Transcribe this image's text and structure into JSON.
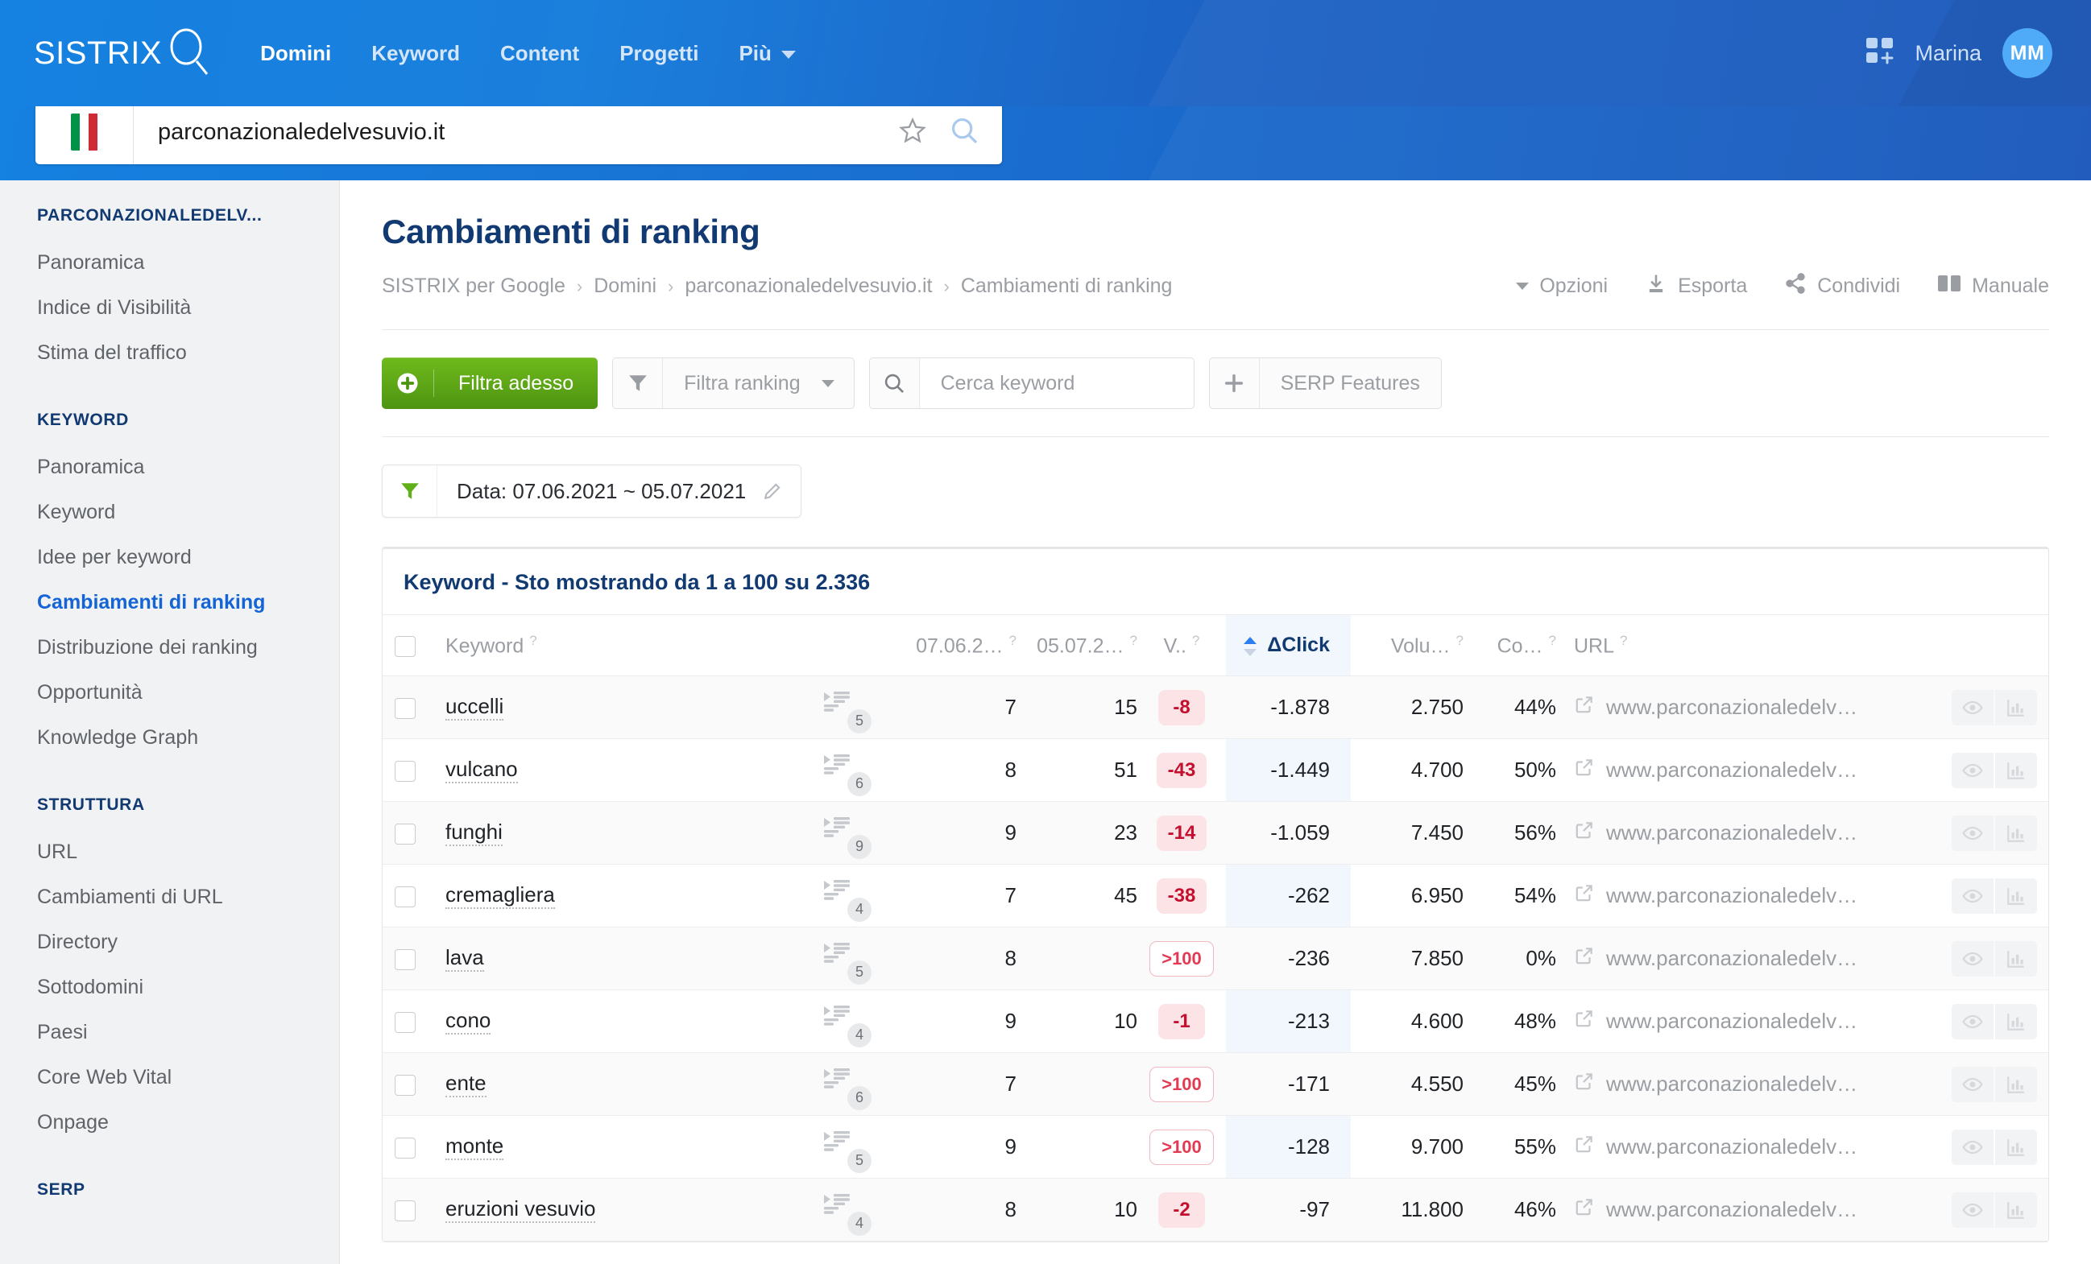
{
  "topnav": {
    "brand": "SISTRIX",
    "menu": [
      {
        "label": "Domini",
        "active": true
      },
      {
        "label": "Keyword",
        "active": false
      },
      {
        "label": "Content",
        "active": false
      },
      {
        "label": "Progetti",
        "active": false
      },
      {
        "label": "Più",
        "active": false,
        "caret": true
      }
    ],
    "apps_icon": "apps-grid-plus-icon",
    "user_name": "Marina",
    "avatar_initials": "MM"
  },
  "search": {
    "flag": "italy-flag",
    "value": "parconazionaledelvesuvio.it",
    "star_icon": "star-outline-icon",
    "search_icon": "magnifier-icon"
  },
  "sidebar": {
    "groups": [
      {
        "header": "PARCONAZIONALEDELV...",
        "items": [
          {
            "label": "Panoramica",
            "active": false
          },
          {
            "label": "Indice di Visibilità",
            "active": false
          },
          {
            "label": "Stima del traffico",
            "active": false
          }
        ]
      },
      {
        "header": "KEYWORD",
        "items": [
          {
            "label": "Panoramica",
            "active": false
          },
          {
            "label": "Keyword",
            "active": false
          },
          {
            "label": "Idee per keyword",
            "active": false
          },
          {
            "label": "Cambiamenti di ranking",
            "active": true
          },
          {
            "label": "Distribuzione dei ranking",
            "active": false
          },
          {
            "label": "Opportunità",
            "active": false
          },
          {
            "label": "Knowledge Graph",
            "active": false
          }
        ]
      },
      {
        "header": "STRUTTURA",
        "items": [
          {
            "label": "URL",
            "active": false
          },
          {
            "label": "Cambiamenti di URL",
            "active": false
          },
          {
            "label": "Directory",
            "active": false
          },
          {
            "label": "Sottodomini",
            "active": false
          },
          {
            "label": "Paesi",
            "active": false
          },
          {
            "label": "Core Web Vital",
            "active": false
          },
          {
            "label": "Onpage",
            "active": false
          }
        ]
      },
      {
        "header": "SERP",
        "items": []
      }
    ]
  },
  "main": {
    "page_title": "Cambiamenti di ranking",
    "breadcrumb": [
      "SISTRIX per Google",
      "Domini",
      "parconazionaledelvesuvio.it",
      "Cambiamenti di ranking"
    ],
    "breadcrumb_separator": "›",
    "actions": [
      {
        "label": "Opzioni",
        "icon": "caret-down-icon"
      },
      {
        "label": "Esporta",
        "icon": "download-icon"
      },
      {
        "label": "Condividi",
        "icon": "share-icon"
      },
      {
        "label": "Manuale",
        "icon": "book-icon"
      }
    ],
    "toolbar": {
      "filter_now": "Filtra adesso",
      "filter_now_icon": "plus-circle-icon",
      "filter_ranking": "Filtra ranking",
      "filter_ranking_icon": "funnel-icon",
      "search_keyword_placeholder": "Cerca keyword",
      "search_keyword_icon": "magnifier-icon",
      "serp_features": "SERP Features",
      "serp_features_icon": "plus-icon"
    },
    "date_chip": {
      "icon": "funnel-green-icon",
      "label": "Data: 07.06.2021 ~ 05.07.2021",
      "edit_icon": "pencil-icon"
    }
  },
  "table": {
    "title": "Keyword - Sto mostrando da 1 a 100 su 2.336",
    "columns": [
      {
        "key": "chk",
        "label": "",
        "help": false
      },
      {
        "key": "kw",
        "label": "Keyword",
        "help": true
      },
      {
        "key": "sf",
        "label": "",
        "help": false
      },
      {
        "key": "d1",
        "label": "07.06.2…",
        "help": true
      },
      {
        "key": "d2",
        "label": "05.07.2…",
        "help": true
      },
      {
        "key": "v",
        "label": "V..",
        "help": true
      },
      {
        "key": "dc",
        "label": "ΔClick",
        "help": false,
        "sorted": true
      },
      {
        "key": "vol",
        "label": "Volu…",
        "help": true
      },
      {
        "key": "co",
        "label": "Co…",
        "help": true
      },
      {
        "key": "url",
        "label": "URL",
        "help": true
      },
      {
        "key": "act",
        "label": "",
        "help": false
      }
    ],
    "rows": [
      {
        "keyword": "uccelli",
        "serp_features": "5",
        "d1": "7",
        "d2": "15",
        "v": "-8",
        "v_out": false,
        "dclick": "-1.878",
        "volume": "2.750",
        "co": "44%",
        "url": "www.parconazionaledelv…"
      },
      {
        "keyword": "vulcano",
        "serp_features": "6",
        "d1": "8",
        "d2": "51",
        "v": "-43",
        "v_out": false,
        "dclick": "-1.449",
        "volume": "4.700",
        "co": "50%",
        "url": "www.parconazionaledelv…"
      },
      {
        "keyword": "funghi",
        "serp_features": "9",
        "d1": "9",
        "d2": "23",
        "v": "-14",
        "v_out": false,
        "dclick": "-1.059",
        "volume": "7.450",
        "co": "56%",
        "url": "www.parconazionaledelv…"
      },
      {
        "keyword": "cremagliera",
        "serp_features": "4",
        "d1": "7",
        "d2": "45",
        "v": "-38",
        "v_out": false,
        "dclick": "-262",
        "volume": "6.950",
        "co": "54%",
        "url": "www.parconazionaledelv…"
      },
      {
        "keyword": "lava",
        "serp_features": "5",
        "d1": "8",
        "d2": "",
        "v": ">100",
        "v_out": true,
        "dclick": "-236",
        "volume": "7.850",
        "co": "0%",
        "url": "www.parconazionaledelv…"
      },
      {
        "keyword": "cono",
        "serp_features": "4",
        "d1": "9",
        "d2": "10",
        "v": "-1",
        "v_out": false,
        "dclick": "-213",
        "volume": "4.600",
        "co": "48%",
        "url": "www.parconazionaledelv…"
      },
      {
        "keyword": "ente",
        "serp_features": "6",
        "d1": "7",
        "d2": "",
        "v": ">100",
        "v_out": true,
        "dclick": "-171",
        "volume": "4.550",
        "co": "45%",
        "url": "www.parconazionaledelv…"
      },
      {
        "keyword": "monte",
        "serp_features": "5",
        "d1": "9",
        "d2": "",
        "v": ">100",
        "v_out": true,
        "dclick": "-128",
        "volume": "9.700",
        "co": "55%",
        "url": "www.parconazionaledelv…"
      },
      {
        "keyword": "eruzioni vesuvio",
        "serp_features": "4",
        "d1": "8",
        "d2": "10",
        "v": "-2",
        "v_out": false,
        "dclick": "-97",
        "volume": "11.800",
        "co": "46%",
        "url": "www.parconazionaledelv…"
      }
    ],
    "row_icons": {
      "serp_feature": "featured-snippet-icon",
      "url_external": "external-link-icon",
      "preview": "eye-icon",
      "chart": "bar-chart-icon"
    }
  },
  "colors": {
    "brand_blue": "#1581e0",
    "deep_blue": "#123a72",
    "accent_link": "#1464d6",
    "green": "#5aa417",
    "negative_red": "#c4102e",
    "pill_bg": "#fbe3e6"
  }
}
